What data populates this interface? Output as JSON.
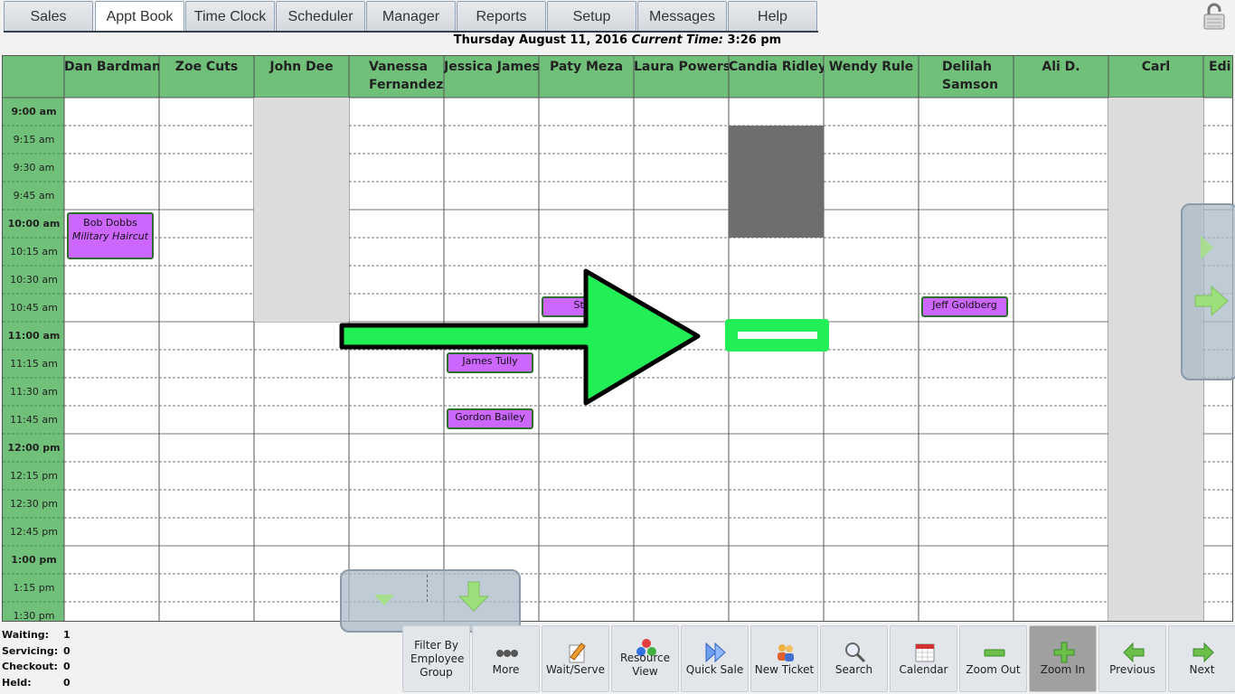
{
  "nav": {
    "tabs": [
      "Sales",
      "Appt Book",
      "Time Clock",
      "Scheduler",
      "Manager",
      "Reports",
      "Setup",
      "Messages",
      "Help"
    ],
    "active": "Appt Book"
  },
  "datebar": {
    "date": "Thursday August 11, 2016",
    "current_label": "Current Time:",
    "current_time": "3:26 pm"
  },
  "employees": [
    "Dan Bardman",
    "Zoe Cuts",
    "John Dee",
    "Vanessa Fernandez",
    "Jessica James",
    "Paty Meza",
    "Laura Powers",
    "Candia Ridley",
    "Wendy Rule",
    "Delilah Samson",
    "Ali D.",
    "Carl",
    "Edi"
  ],
  "times": [
    "9:00 am",
    "9:15 am",
    "9:30 am",
    "9:45 am",
    "10:00 am",
    "10:15 am",
    "10:30 am",
    "10:45 am",
    "11:00 am",
    "11:15 am",
    "11:30 am",
    "11:45 am",
    "12:00 pm",
    "12:15 pm",
    "12:30 pm",
    "12:45 pm",
    "1:00 pm",
    "1:15 pm",
    "1:30 pm"
  ],
  "appointments": [
    {
      "client": "Bob Dobbs",
      "service": "Military Haircut"
    },
    {
      "client": "Steu"
    },
    {
      "client": "Jeff Goldberg"
    },
    {
      "client": "James Tully"
    },
    {
      "client": "Gordon Bailey"
    }
  ],
  "status": {
    "waiting_label": "Waiting:",
    "waiting": "1",
    "servicing_label": "Servicing:",
    "servicing": "0",
    "checkout_label": "Checkout:",
    "checkout": "0",
    "held_label": "Held:",
    "held": "0"
  },
  "toolbar": {
    "filter": "Filter By Employee Group",
    "more": "More",
    "wait_serve": "Wait/Serve",
    "resource_view": "Resource View",
    "quick_sale": "Quick Sale",
    "new_ticket": "New Ticket",
    "search": "Search",
    "calendar": "Calendar",
    "zoom_out": "Zoom Out",
    "zoom_in": "Zoom In",
    "previous": "Previous",
    "next": "Next"
  },
  "colors": {
    "header_green": "#70c07a",
    "appointment": "#cc66ff",
    "annotation_arrow": "#22ee55"
  },
  "icons": {
    "lock": "padlock-open-icon",
    "more": "dots-icon",
    "wait_serve": "pencil-paper-icon",
    "resource_view": "colored-balls-icon",
    "quick_sale": "double-arrow-icon",
    "new_ticket": "people-icon",
    "search": "magnifier-icon",
    "calendar": "calendar-icon",
    "zoom_out": "minus-icon",
    "zoom_in": "plus-icon",
    "previous": "left-arrow-icon",
    "next": "right-arrow-icon"
  }
}
